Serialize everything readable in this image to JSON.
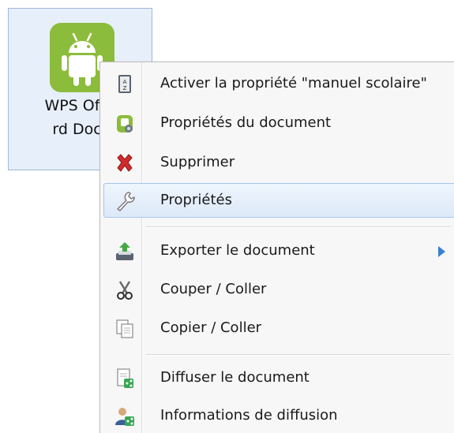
{
  "desktop_file": {
    "icon": "android-icon",
    "label_line1": "WPS Offic",
    "label_line2": "rd Docs"
  },
  "context_menu": {
    "items": [
      {
        "label": "Activer la propriété \"manuel scolaire\"",
        "icon": "az-book-icon"
      },
      {
        "label": "Propriétés du document",
        "icon": "document-properties-icon"
      },
      {
        "label": "Supprimer",
        "icon": "red-x-icon"
      },
      {
        "label": "Propriétés",
        "icon": "wrench-icon",
        "highlighted": true
      },
      {
        "label": "Exporter le document",
        "icon": "export-icon",
        "has_submenu": true
      },
      {
        "label": "Couper / Coller",
        "icon": "scissors-icon"
      },
      {
        "label": "Copier / Coller",
        "icon": "copy-icon"
      },
      {
        "label": "Diffuser le document",
        "icon": "share-document-icon"
      },
      {
        "label": "Informations de diffusion",
        "icon": "user-share-icon"
      }
    ]
  },
  "colors": {
    "highlight_border": "#a7c4ec",
    "highlight_fill": "#dde9f8",
    "app_icon_green": "#8cbc3c",
    "submenu_arrow": "#3a7fd4"
  }
}
